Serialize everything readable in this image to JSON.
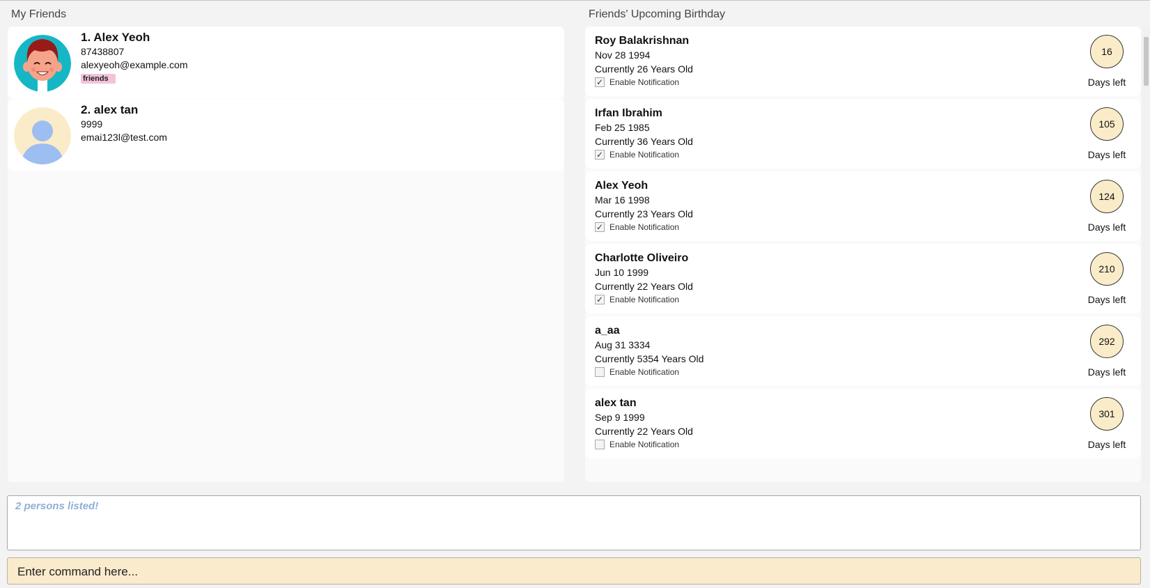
{
  "friends_panel": {
    "title": "My Friends",
    "persons": [
      {
        "index_name": "1. Alex Yeoh",
        "phone": "87438807",
        "email": "alexyeoh@example.com",
        "tags": [
          "friends"
        ],
        "avatar": "cartoon-boy-avatar"
      },
      {
        "index_name": "2. alex tan",
        "phone": "9999",
        "email": "emai123l@test.com",
        "tags": [],
        "avatar": "default-person-avatar"
      }
    ]
  },
  "birthday_panel": {
    "title": "Friends' Upcoming Birthday",
    "days_left_label": "Days left",
    "notification_label": "Enable Notification",
    "entries": [
      {
        "name": "Roy Balakrishnan",
        "date": "Nov 28 1994",
        "age": "Currently 26 Years Old",
        "notify": true,
        "days": "16"
      },
      {
        "name": "Irfan Ibrahim",
        "date": "Feb 25 1985",
        "age": "Currently 36 Years Old",
        "notify": true,
        "days": "105"
      },
      {
        "name": "Alex Yeoh",
        "date": "Mar 16 1998",
        "age": "Currently 23 Years Old",
        "notify": true,
        "days": "124"
      },
      {
        "name": "Charlotte Oliveiro",
        "date": "Jun 10 1999",
        "age": "Currently 22 Years Old",
        "notify": true,
        "days": "210"
      },
      {
        "name": "a_aa",
        "date": "Aug 31 3334",
        "age": "Currently 5354 Years Old",
        "notify": false,
        "days": "292"
      },
      {
        "name": "alex tan",
        "date": "Sep 9 1999",
        "age": "Currently 22 Years Old",
        "notify": false,
        "days": "301"
      }
    ]
  },
  "result_display": {
    "text": "2 persons listed!"
  },
  "command_box": {
    "placeholder": "Enter command here..."
  },
  "colors": {
    "command_bg": "#faebcd",
    "days_circle_bg": "#fbecc9",
    "tag_bg": "#f1c4d9",
    "result_text": "#8fb0d6"
  }
}
